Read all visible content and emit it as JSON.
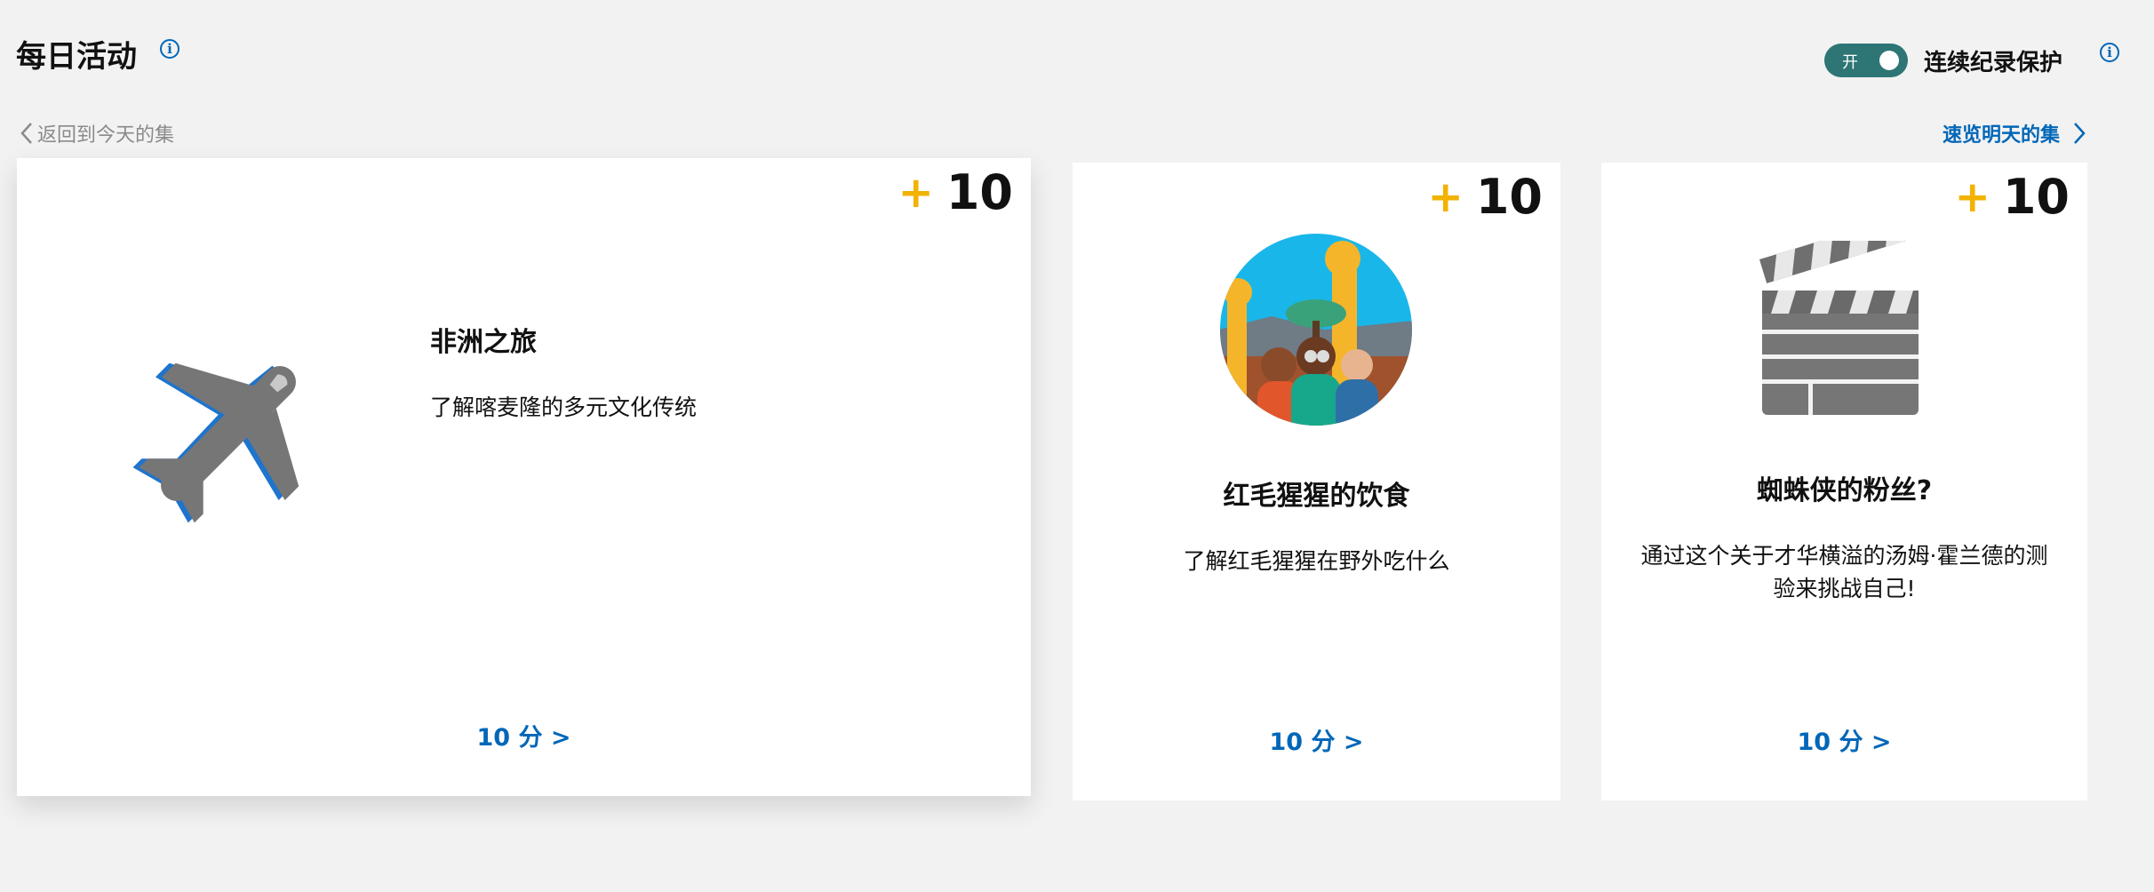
{
  "header": {
    "title": "每日活动",
    "streak_toggle": "开",
    "streak_label": "连续纪录保护"
  },
  "nav": {
    "back": "返回到今天的集",
    "forward": "速览明天的集"
  },
  "cards": [
    {
      "points_plus": "+",
      "points": "10",
      "title": "非洲之旅",
      "description": "了解喀麦隆的多元文化传统",
      "link": "10 分 >",
      "icon": "airplane-icon"
    },
    {
      "points_plus": "+",
      "points": "10",
      "title": "红毛猩猩的饮食",
      "description": "了解红毛猩猩在野外吃什么",
      "link": "10 分 >",
      "icon": "safari-people-icon"
    },
    {
      "points_plus": "+",
      "points": "10",
      "title": "蜘蛛侠的粉丝?",
      "description": "通过这个关于才华横溢的汤姆·霍兰德的测验来挑战自己!",
      "link": "10 分 >",
      "icon": "clapperboard-icon"
    }
  ],
  "colors": {
    "accent_blue": "#0067b8",
    "points_yellow": "#f2b300",
    "toggle_on": "#2e7575",
    "background": "#f2f2f2"
  }
}
